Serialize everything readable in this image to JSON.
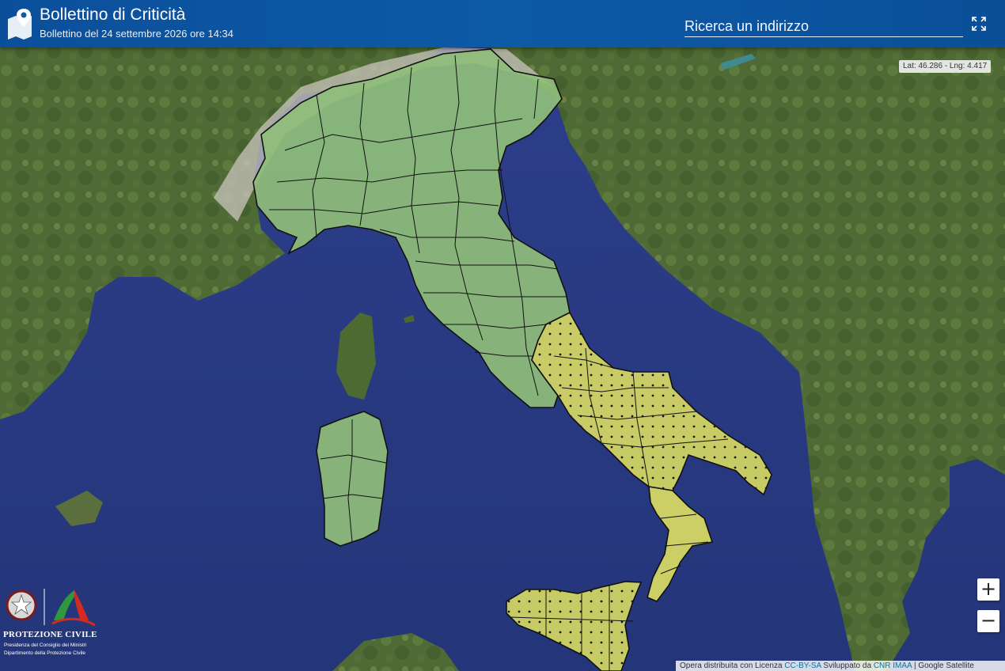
{
  "header": {
    "title": "Bollettino di Criticità",
    "subtitle": "Bollettino del 24 settembre 2026 ore 14:34",
    "logo_icon": "map-pin-icon",
    "fullscreen_icon": "fullscreen-icon"
  },
  "search": {
    "placeholder": "Ricerca un indirizzo",
    "icon": "search-field"
  },
  "map": {
    "coordinates": "Lat: 46.286 - Lng: 4.417",
    "zoom_in_label": "+",
    "zoom_out_label": "−",
    "base_layer": "Google Satellite",
    "alert_colors": {
      "green": "#8fbe7a",
      "yellow": "#d9dc63"
    },
    "zones": [
      {
        "area": "Nord e Centro Italia",
        "level": "green"
      },
      {
        "area": "Sardegna",
        "level": "green"
      },
      {
        "area": "Sud Italia e Puglia",
        "level": "yellow"
      },
      {
        "area": "Calabria",
        "level": "yellow"
      },
      {
        "area": "Sicilia",
        "level": "yellow"
      }
    ]
  },
  "attribution": {
    "prefix": "Opera distribuita con Licenza",
    "license_link": "CC-BY-SA",
    "middle": "Sviluppato da",
    "developer_link": "CNR IMAA",
    "separator": "|",
    "layer": "Google Satellite"
  },
  "logo": {
    "name": "PROTEZIONE CIVILE",
    "line1": "Presidenza del Consiglio dei Ministri",
    "line2": "Dipartimento della Protezione Civile"
  }
}
